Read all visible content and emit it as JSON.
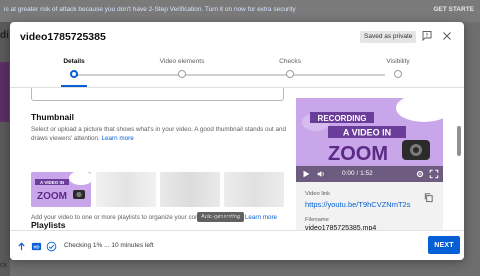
{
  "background": {
    "banner_text": "is at greater risk of attack because you don't have 2-Step Verification. Turn it on now for extra security",
    "banner_action": "GET STARTE",
    "partial_letter": "di",
    "bottom_text": "ck"
  },
  "dialog": {
    "title": "video1785725385",
    "saved_badge": "Saved as private",
    "icons": {
      "alert": "alert-feedback-icon",
      "close": "close-icon"
    }
  },
  "stepper": {
    "steps": [
      {
        "label": "Details",
        "active": true
      },
      {
        "label": "Video elements",
        "active": false
      },
      {
        "label": "Checks",
        "active": false
      },
      {
        "label": "Visibility",
        "active": false
      }
    ]
  },
  "thumbnail": {
    "title": "Thumbnail",
    "description": "Select or upload a picture that shows what's in your video. A good thumbnail stands out and draws viewers' attention.",
    "learn_more": "Learn more",
    "tooltip": "Auto-generating",
    "thumb_text_1": "A VIDEO IN",
    "thumb_text_2": "ZOOM"
  },
  "playlists": {
    "title": "Playlists",
    "description": "Add your video to one or more playlists to organize your content for viewers.",
    "learn_more": "Learn more"
  },
  "preview": {
    "text_line1": "RECORDING",
    "text_line2": "A VIDEO IN",
    "text_line3": "ZOOM",
    "time": "0:00 / 1:52"
  },
  "video_info": {
    "link_label": "Video link",
    "link": "https://youtu.be/T9hCVZNmT2s",
    "filename_label": "Filename",
    "filename": "video1785725385.mp4"
  },
  "footer": {
    "status": "Checking 1% ... 10 minutes left",
    "next_label": "NEXT",
    "hd_label": "HD"
  },
  "colors": {
    "accent": "#065fd4",
    "thumbnail_bg": "#c9a6ea",
    "title_text": "#5b2a86"
  }
}
